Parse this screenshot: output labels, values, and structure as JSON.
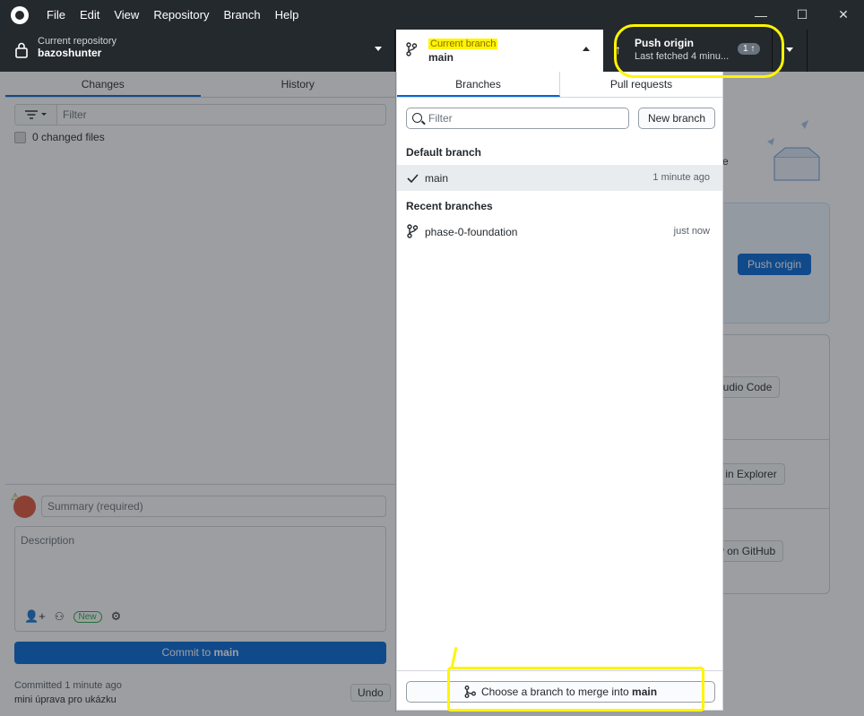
{
  "menu": [
    "File",
    "Edit",
    "View",
    "Repository",
    "Branch",
    "Help"
  ],
  "window_controls": {
    "minimize": "—",
    "maximize": "☐",
    "close": "✕"
  },
  "toolbar": {
    "repo_label": "Current repository",
    "repo_name": "bazoshunter",
    "branch_label": "Current branch",
    "branch_name": "main",
    "push_title": "Push origin",
    "push_subtitle": "Last fetched 4 minu...",
    "push_badge": "1 ↑"
  },
  "sidebar": {
    "tabs": [
      "Changes",
      "History"
    ],
    "filter_placeholder": "Filter",
    "changed_files": "0 changed files",
    "summary_placeholder": "Summary (required)",
    "description_placeholder": "Description",
    "new_pill": "New",
    "commit_prefix": "Commit to ",
    "commit_branch": "main",
    "last_commit_time": "Committed 1 minute ago",
    "last_commit_message": "mini úprava pro ukázku",
    "undo": "Undo"
  },
  "main": {
    "partial_text": "e",
    "push_button": "Push origin",
    "open_editor_button": "sual Studio Code",
    "show_explorer_button": "Show in Explorer",
    "view_github_button": "View on GitHub"
  },
  "dropdown": {
    "tabs": [
      "Branches",
      "Pull requests"
    ],
    "filter_placeholder": "Filter",
    "new_branch": "New branch",
    "default_heading": "Default branch",
    "default_branch": {
      "name": "main",
      "time": "1 minute ago"
    },
    "recent_heading": "Recent branches",
    "recent_branches": [
      {
        "name": "phase-0-foundation",
        "time": "just now"
      }
    ],
    "merge_prefix": "Choose a branch to merge into ",
    "merge_branch": "main"
  },
  "colors": {
    "highlight": "#fff500",
    "accent": "#0366d6",
    "toolbar_bg": "#24292e"
  }
}
